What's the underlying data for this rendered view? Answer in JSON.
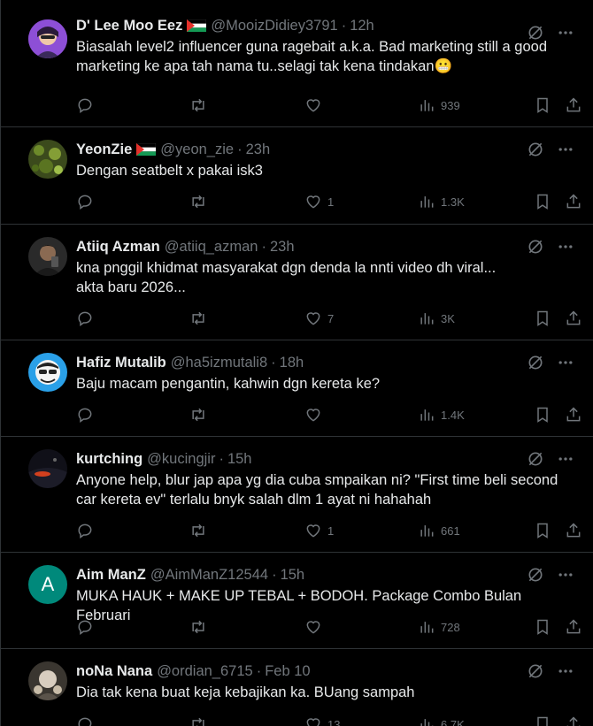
{
  "tweets": [
    {
      "name": "D' Lee Moo Eez",
      "flag": true,
      "handle": "@MooizDidiey3791",
      "time": "12h",
      "text": "Biasalah level2 influencer guna ragebait a.k.a. Bad marketing still a good marketing ke apa tah nama tu..selagi tak kena tindakan😬",
      "likes": "",
      "views": "939"
    },
    {
      "name": "YeonZie",
      "flag": true,
      "handle": "@yeon_zie",
      "time": "23h",
      "text": "Dengan seatbelt x pakai isk3",
      "likes": "1",
      "views": "1.3K"
    },
    {
      "name": "Atiiq Azman",
      "flag": false,
      "handle": "@atiiq_azman",
      "time": "23h",
      "text": "kna pnggil khidmat masyarakat dgn denda la nnti video dh viral... akta baru 2026...",
      "likes": "7",
      "views": "3K"
    },
    {
      "name": "Hafiz Mutalib",
      "flag": false,
      "handle": "@ha5izmutali8",
      "time": "18h",
      "text": "Baju macam pengantin, kahwin dgn kereta ke?",
      "likes": "",
      "views": "1.4K"
    },
    {
      "name": "kurtching",
      "flag": false,
      "handle": "@kucingjir",
      "time": "15h",
      "text": "Anyone help, blur jap apa yg dia cuba smpaikan ni? \"First time beli second car kereta ev\" terlalu bnyk salah dlm 1 ayat ni hahahah",
      "likes": "1",
      "views": "661"
    },
    {
      "name": "Aim ManZ",
      "flag": false,
      "handle": "@AimManZ12544",
      "time": "15h",
      "text": "MUKA HAUK + MAKE UP TEBAL + BODOH.  Package Combo Bulan Februari",
      "likes": "",
      "views": "728",
      "avatar_letter": "A"
    },
    {
      "name": "noNa Nana",
      "flag": false,
      "handle": "@ordian_6715",
      "time": "Feb 10",
      "text": "Dia tak kena buat keja kebajikan ka. BUang sampah",
      "likes": "13",
      "views": "6.7K"
    }
  ],
  "icons": {
    "reply": "reply-icon",
    "retweet": "retweet-icon",
    "like": "like-icon",
    "views": "views-icon",
    "bookmark": "bookmark-icon",
    "share": "share-icon",
    "grok": "grok-icon",
    "more": "more-icon"
  },
  "colors": {
    "background": "#000000",
    "text": "#e7e9ea",
    "muted": "#71767b",
    "border": "#2f3336"
  }
}
